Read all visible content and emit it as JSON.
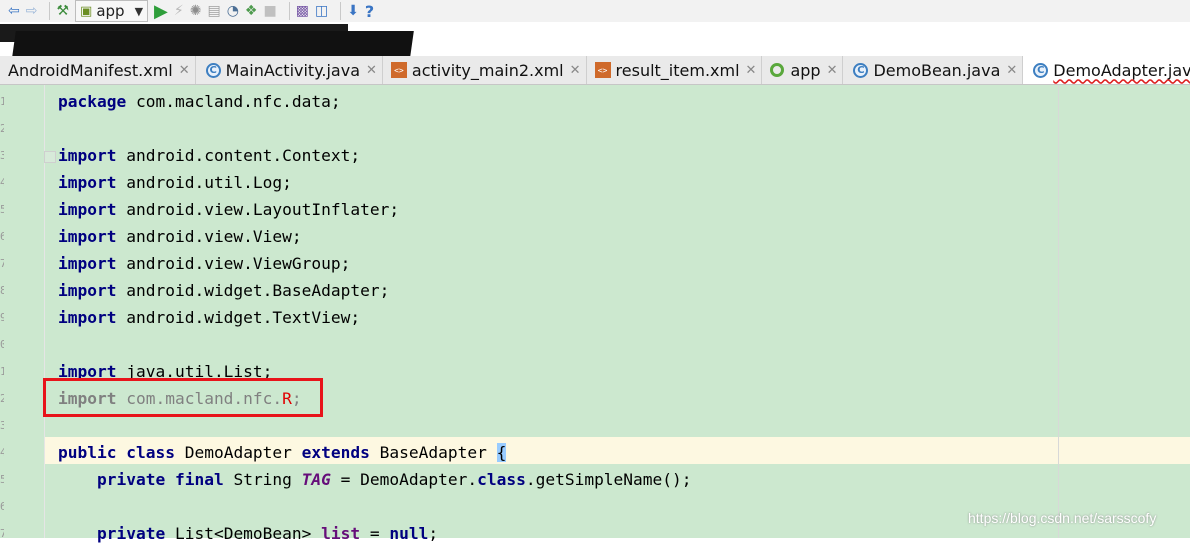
{
  "toolbar": {
    "run_config": "app",
    "icons": [
      "back-icon",
      "forward-icon",
      "build-hammer-icon",
      "run-icon",
      "apply-changes-icon",
      "debug-icon",
      "attach-debugger-icon",
      "profile-icon",
      "coverage-icon",
      "stop-icon",
      "sync-gradle-icon",
      "sdk-manager-icon",
      "device-manager-icon",
      "help-icon"
    ]
  },
  "obscured_text": "",
  "tabs": [
    {
      "label": "AndroidManifest.xml",
      "icon": "xml-file-icon"
    },
    {
      "label": "MainActivity.java",
      "icon": "java-class-icon"
    },
    {
      "label": "activity_main2.xml",
      "icon": "xml-layout-icon"
    },
    {
      "label": "result_item.xml",
      "icon": "xml-layout-icon"
    },
    {
      "label": "app",
      "icon": "android-module-icon"
    },
    {
      "label": "DemoBean.java",
      "icon": "java-class-icon"
    },
    {
      "label": "DemoAdapter.java",
      "icon": "java-class-icon",
      "active": true
    }
  ],
  "line_numbers": [
    "1",
    "2",
    "3",
    "4",
    "5",
    "6",
    "7",
    "8",
    "9",
    "0",
    "1",
    "2",
    "3",
    "4",
    "5",
    "6",
    "7"
  ],
  "code": {
    "l1_kw": "package",
    "l1_rest": " com.macland.nfc.data;",
    "l3_kw": "import",
    "l3_rest": " android.content.Context;",
    "l4_kw": "import",
    "l4_rest": " android.util.Log;",
    "l5_kw": "import",
    "l5_rest": " android.view.LayoutInflater;",
    "l6_kw": "import",
    "l6_rest": " android.view.View;",
    "l7_kw": "import",
    "l7_rest": " android.view.ViewGroup;",
    "l8_kw": "import",
    "l8_rest": " android.widget.BaseAdapter;",
    "l9_kw": "import",
    "l9_rest": " android.widget.TextView;",
    "l11_kw": "import",
    "l11_rest": " java.util.List;",
    "l12_kw": "import",
    "l12_rest": " com.macland.nfc.",
    "l12_r": "R",
    "l12_end": ";",
    "l14_kw1": "public",
    "l14_kw2": "class",
    "l14_name": " DemoAdapter ",
    "l14_kw3": "extends",
    "l14_base": " BaseAdapter ",
    "l14_brace": "{",
    "l15_kw1": "private",
    "l15_kw2": "final",
    "l15_type": " String ",
    "l15_const": "TAG",
    "l15_mid": " = DemoAdapter.",
    "l15_kw3": "class",
    "l15_end": ".getSimpleName();",
    "l17_kw": "private",
    "l17_mid": " List<DemoBean> ",
    "l17_field": "list",
    "l17_eq": " = ",
    "l17_null": "null",
    "l17_end": ";"
  },
  "watermark": "https://blog.csdn.net/sarsscofy"
}
